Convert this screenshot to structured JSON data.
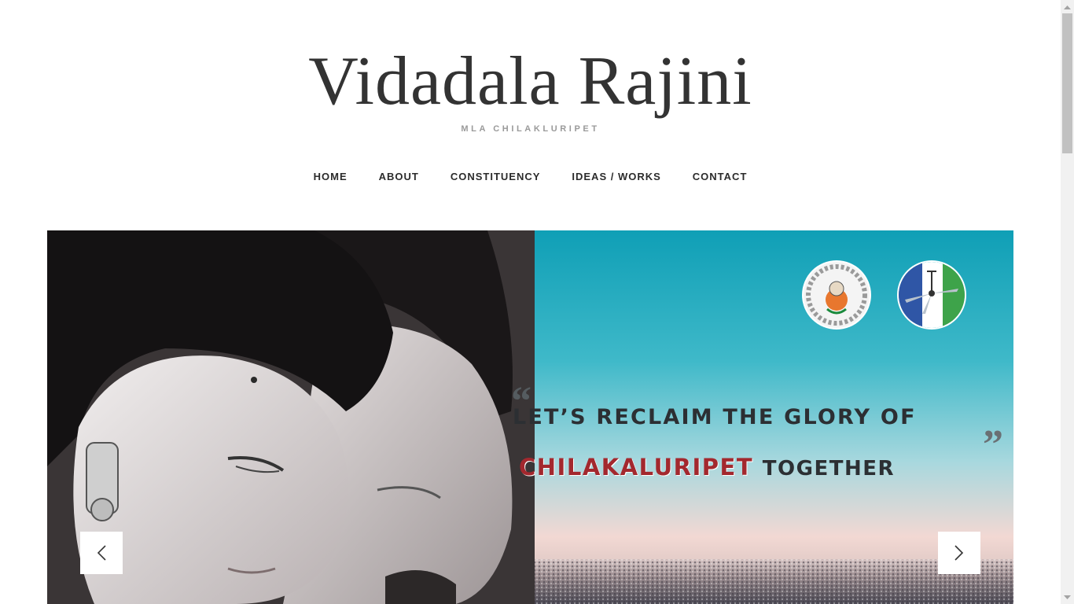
{
  "site": {
    "title": "Vidadala Rajini",
    "tagline": "MLA CHILAKLURIPET"
  },
  "nav": {
    "items": [
      {
        "label": "HOME"
      },
      {
        "label": "ABOUT"
      },
      {
        "label": "CONSTITUENCY"
      },
      {
        "label": "IDEAS / WORKS"
      },
      {
        "label": "CONTACT"
      }
    ]
  },
  "hero": {
    "quote_open": "“",
    "quote_line_1": "LET’S RECLAIM THE GLORY OF",
    "quote_highlight": "CHILAKALURIPET",
    "quote_rest": "TOGETHER",
    "quote_close": "”",
    "prev_icon": "chevron-left-icon",
    "next_icon": "chevron-right-icon"
  },
  "colors": {
    "title": "#333333",
    "tagline": "#9a9a9a",
    "nav": "#2b2b2b",
    "sky_top": "#1ea5b8",
    "sky_bottom": "#f4d6d0",
    "highlight": "#a3282e",
    "party_blue": "#2f56a6",
    "party_green": "#3ea34a"
  }
}
